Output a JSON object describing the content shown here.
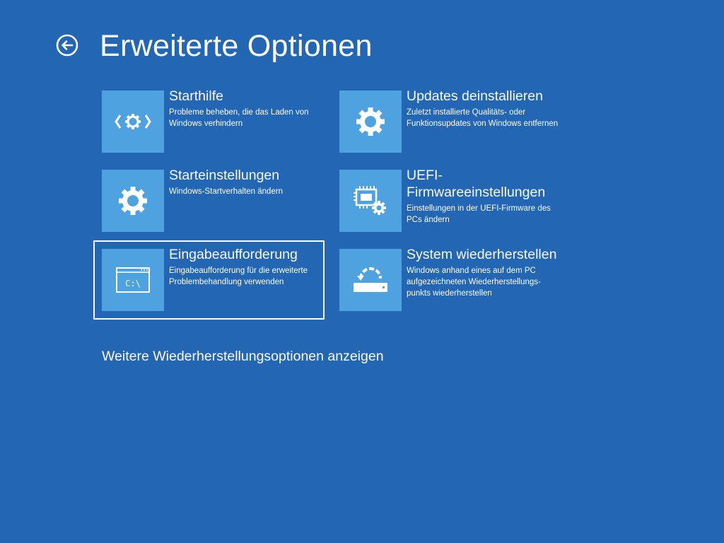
{
  "header": {
    "title": "Erweiterte Optionen",
    "back_icon": "back-arrow-circle-icon"
  },
  "options": [
    {
      "title": "Starthilfe",
      "description": "Probleme beheben, die das Laden von Windows verhindern",
      "icon": "startup-repair-icon"
    },
    {
      "title": "Updates deinstallieren",
      "description": "Zuletzt installierte Qualitäts- oder Funktionsupdates von Windows entfernen",
      "icon": "gear-icon"
    },
    {
      "title": "Starteinstellungen",
      "description": "Windows-Startverhalten ändern",
      "icon": "gear-icon"
    },
    {
      "title": "UEFI-Firmwareeinstellungen",
      "description": "Einstellungen in der UEFI-Firmware des PCs ändern",
      "icon": "chip-gear-icon"
    },
    {
      "title": "Eingabeaufforderung",
      "description": "Eingabeaufforderung für die erweiterte Problembehandlung verwenden",
      "icon": "command-prompt-icon",
      "icon_text": "C:\\",
      "selected": true
    },
    {
      "title": "System wiederherstellen",
      "description": "Windows anhand eines auf dem PC aufgezeichneten Wiederherstellungs-punkts wiederherstellen",
      "icon": "system-restore-icon"
    }
  ],
  "footer": {
    "more_options_label": "Weitere Wiederherstellungsoptionen anzeigen"
  },
  "colors": {
    "background": "#2266b4",
    "tile_icon_background": "#4ea2e0",
    "text": "#ffffff"
  }
}
